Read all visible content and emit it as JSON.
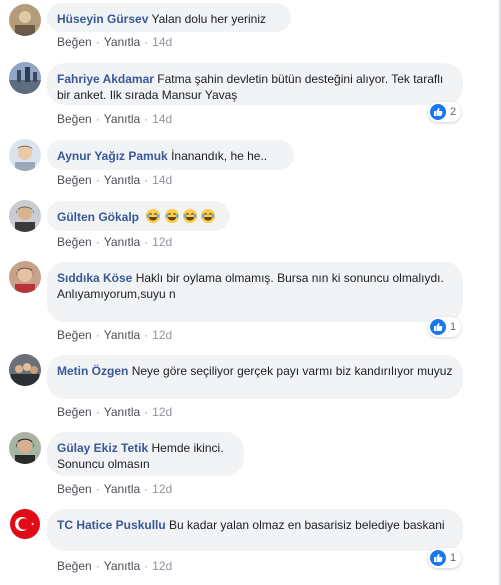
{
  "actions": {
    "like": "Beğen",
    "reply": "Yanıtla",
    "separator": "·"
  },
  "comments": [
    {
      "author": "Hüseyin Gürsev",
      "text": "Yalan dolu her yeriniz",
      "time": "14d",
      "reactions": ""
    },
    {
      "author": "Fahriye Akdamar",
      "text": "Fatma şahin devletin bütün desteğini alıyor. Tek taraflı bir anket. Ilk sırada Mansur Yavaş",
      "time": "14d",
      "reactions": "2"
    },
    {
      "author": "Aynur Yağız Pamuk",
      "text": "İnanandık, he he..",
      "time": "14d",
      "reactions": ""
    },
    {
      "author": "Gülten Gökalp",
      "text": "",
      "time": "12d",
      "reactions": "",
      "emoji": "laughing-crying-face x4"
    },
    {
      "author": "Sıddıka Köse",
      "text": "Haklı bir oylama olmamış. Bursa nın ki sonuncu olmalıydı. Anlıyamıyorum,suyu n",
      "time": "12d",
      "reactions": "1"
    },
    {
      "author": "Metin Özgen",
      "text": "Neye göre seçiliyor gerçek payı varmı biz kandırılıyor muyuz",
      "time": "12d",
      "reactions": ""
    },
    {
      "author": "Gülay Ekiz Tetik",
      "text": "Hemde ikinci. Sonuncu olmasın",
      "time": "12d",
      "reactions": ""
    },
    {
      "author": "TC Hatice Puskullu",
      "text": "Bu kadar yalan olmaz en basarisiz belediye baskani",
      "time": "12d",
      "reactions": "1"
    }
  ],
  "colors": {
    "name": "#385898",
    "bubble": "#f2f3f5",
    "like": "#1877f2",
    "meta": "#90949c"
  }
}
